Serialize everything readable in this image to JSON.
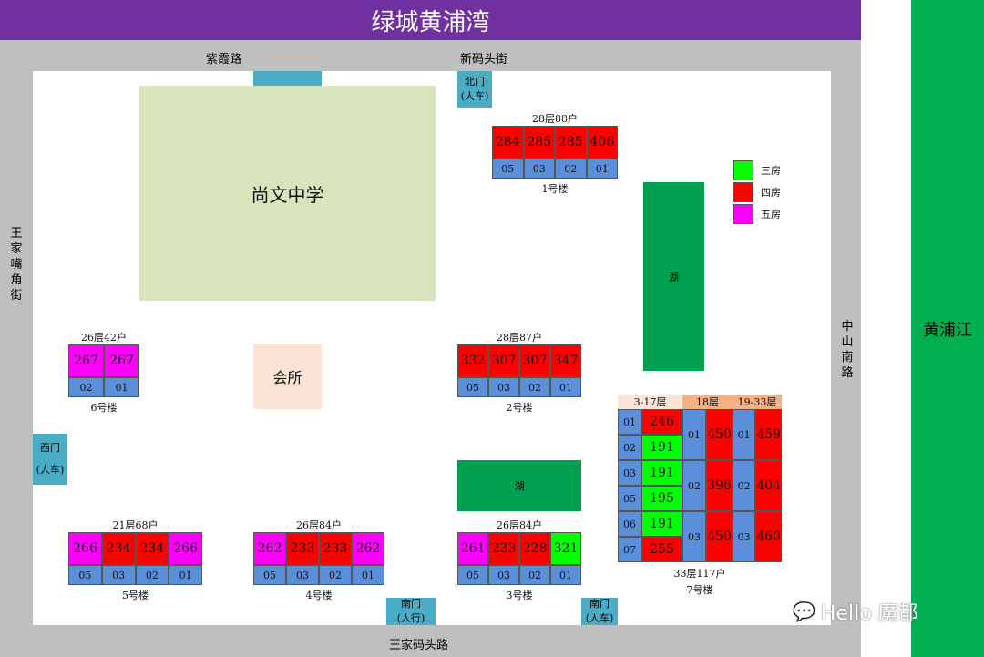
{
  "title": "绿城黄浦湾",
  "roads": {
    "north_left": "紫霞路",
    "north_right": "新码头街",
    "west": "王家嘴角街",
    "east": "中山南路",
    "south": "王家码头路"
  },
  "river": "黄浦江",
  "gates": {
    "north": [
      "北门",
      "(人车)"
    ],
    "west": [
      "西门",
      "(人车)"
    ],
    "south_walk": [
      "南门",
      "(人行)"
    ],
    "south_car": [
      "南门",
      "(人车)"
    ]
  },
  "landmarks": {
    "school": "尚文中学",
    "club": "会所",
    "lake": "湖"
  },
  "legend": [
    {
      "label": "三房",
      "color": "#00ff00"
    },
    {
      "label": "四房",
      "color": "#ff0000"
    },
    {
      "label": "五房",
      "color": "#ff00ff"
    }
  ],
  "colors": {
    "three": "#00ff00",
    "four": "#ff0000",
    "five": "#ff00ff",
    "unit": "#5b8fd9"
  },
  "buildings": {
    "b1": {
      "info": "28层88户",
      "name": "1号楼",
      "cells": [
        {
          "v": "284",
          "t": "four"
        },
        {
          "v": "285",
          "t": "four"
        },
        {
          "v": "285",
          "t": "four"
        },
        {
          "v": "406",
          "t": "four"
        }
      ],
      "units": [
        "05",
        "03",
        "02",
        "01"
      ]
    },
    "b2": {
      "info": "28层87户",
      "name": "2号楼",
      "cells": [
        {
          "v": "332",
          "t": "four"
        },
        {
          "v": "307",
          "t": "four"
        },
        {
          "v": "307",
          "t": "four"
        },
        {
          "v": "347",
          "t": "four"
        }
      ],
      "units": [
        "05",
        "03",
        "02",
        "01"
      ]
    },
    "b3": {
      "info": "26层84户",
      "name": "3号楼",
      "cells": [
        {
          "v": "261",
          "t": "five"
        },
        {
          "v": "233",
          "t": "four"
        },
        {
          "v": "228",
          "t": "four"
        },
        {
          "v": "321",
          "t": "three"
        }
      ],
      "units": [
        "05",
        "03",
        "02",
        "01"
      ]
    },
    "b4": {
      "info": "26层84户",
      "name": "4号楼",
      "cells": [
        {
          "v": "262",
          "t": "five"
        },
        {
          "v": "233",
          "t": "four"
        },
        {
          "v": "233",
          "t": "four"
        },
        {
          "v": "262",
          "t": "five"
        }
      ],
      "units": [
        "05",
        "03",
        "02",
        "01"
      ]
    },
    "b5": {
      "info": "21层68户",
      "name": "5号楼",
      "cells": [
        {
          "v": "266",
          "t": "five"
        },
        {
          "v": "234",
          "t": "four"
        },
        {
          "v": "234",
          "t": "four"
        },
        {
          "v": "266",
          "t": "five"
        }
      ],
      "units": [
        "05",
        "03",
        "02",
        "01"
      ]
    },
    "b6": {
      "info": "26层42户",
      "name": "6号楼",
      "cells": [
        {
          "v": "267",
          "t": "five"
        },
        {
          "v": "267",
          "t": "five"
        }
      ],
      "units": [
        "02",
        "01"
      ]
    },
    "b7": {
      "info": "33层117户",
      "name": "7号楼",
      "headers": [
        "3-17层",
        "18层",
        "19-33层"
      ],
      "sec1": [
        {
          "u": "01",
          "v": "246",
          "t": "four"
        },
        {
          "u": "02",
          "v": "191",
          "t": "three"
        },
        {
          "u": "03",
          "v": "191",
          "t": "three"
        },
        {
          "u": "05",
          "v": "195",
          "t": "three"
        },
        {
          "u": "06",
          "v": "191",
          "t": "three"
        },
        {
          "u": "07",
          "v": "255",
          "t": "four"
        }
      ],
      "sec2": [
        {
          "u": "01",
          "v": "450",
          "t": "four"
        },
        {
          "u": "02",
          "v": "396",
          "t": "four"
        },
        {
          "u": "03",
          "v": "450",
          "t": "four"
        }
      ],
      "sec3": [
        {
          "u": "01",
          "v": "459",
          "t": "four"
        },
        {
          "u": "02",
          "v": "404",
          "t": "four"
        },
        {
          "u": "03",
          "v": "460",
          "t": "four"
        }
      ]
    }
  },
  "watermark": "Hello 魔都"
}
